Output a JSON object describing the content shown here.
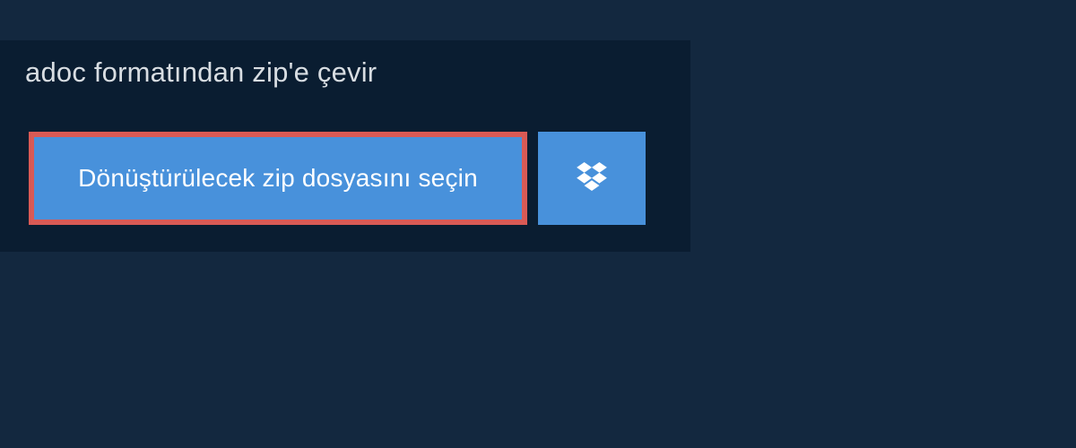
{
  "title": "adoc formatından zip'e çevir",
  "actions": {
    "select_file_label": "Dönüştürülecek zip dosyasını seçin"
  }
}
